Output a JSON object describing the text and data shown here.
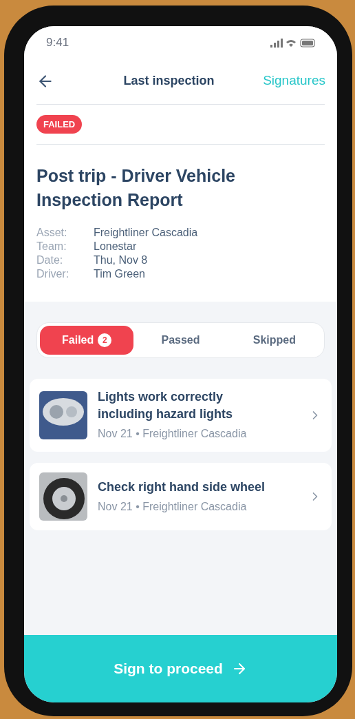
{
  "status_bar": {
    "time": "9:41"
  },
  "header": {
    "title": "Last inspection",
    "action": "Signatures"
  },
  "status_badge": {
    "label": "FAILED",
    "kind": "failed"
  },
  "report": {
    "title": "Post trip - Driver Vehicle Inspection Report",
    "details": [
      {
        "label": "Asset:",
        "value": "Freightliner Cascadia"
      },
      {
        "label": "Team:",
        "value": "Lonestar"
      },
      {
        "label": "Date:",
        "value": "Thu, Nov 8"
      },
      {
        "label": "Driver:",
        "value": "Tim Green"
      }
    ]
  },
  "tabs": [
    {
      "label": "Failed",
      "count": "2",
      "selected": true
    },
    {
      "label": "Passed",
      "selected": false
    },
    {
      "label": "Skipped",
      "selected": false
    }
  ],
  "items": [
    {
      "title": "Lights work correctly including hazard lights",
      "subtitle": "Nov 21 • Freightliner Cascadia",
      "kind": "headlight"
    },
    {
      "title": "Check right hand side wheel",
      "subtitle": "Nov 21 • Freightliner Cascadia",
      "kind": "wheel"
    }
  ],
  "footer_button": {
    "label": "Sign to proceed"
  }
}
